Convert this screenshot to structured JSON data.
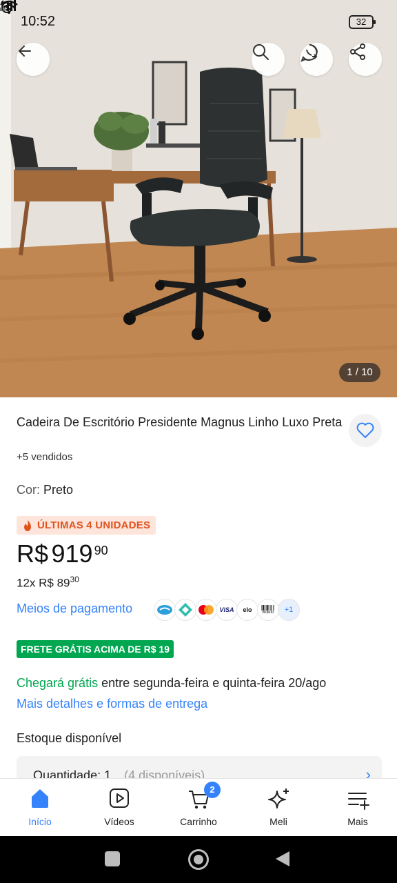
{
  "status_bar": {
    "time": "10:52",
    "battery": "32"
  },
  "gallery": {
    "counter": "1 / 10"
  },
  "product": {
    "title": "Cadeira De Escritório Presidente Magnus Linho Luxo Preta",
    "sold": "+5 vendidos",
    "color_label": "Cor:",
    "color_value": "Preto",
    "urgency": "ÚLTIMAS 4 UNIDADES",
    "price_currency": "R$",
    "price_integer": "919",
    "price_cents": "90",
    "installments_prefix": "12x R$ 89",
    "installments_cents": "30"
  },
  "payment": {
    "link": "Meios de pagamento",
    "methods": [
      "mercado-pago-icon",
      "pix-icon",
      "mastercard-icon",
      "VISA",
      "elo",
      "Boleto"
    ],
    "more": "+1"
  },
  "shipping": {
    "badge": "FRETE GRÁTIS ACIMA DE R$ 19",
    "arrival_highlight": "Chegará grátis",
    "arrival_rest": "entre segunda-feira e quinta-feira 20/ago",
    "details_link": "Mais detalhes e formas de entrega"
  },
  "stock": {
    "label": "Estoque disponível",
    "quantity_label": "Quantidade:",
    "quantity_value": "1",
    "available": "(4 disponíveis)"
  },
  "bottom_nav": {
    "items": [
      {
        "label": "Início",
        "icon": "home-icon"
      },
      {
        "label": "Vídeos",
        "icon": "video-icon"
      },
      {
        "label": "Carrinho",
        "icon": "cart-icon"
      },
      {
        "label": "Meli",
        "icon": "sparkle-icon"
      },
      {
        "label": "Mais",
        "icon": "menu-icon"
      }
    ],
    "cart_count": "2"
  },
  "colors": {
    "accent": "#3483fa",
    "green": "#00a650",
    "urgency": "#e0531f"
  }
}
